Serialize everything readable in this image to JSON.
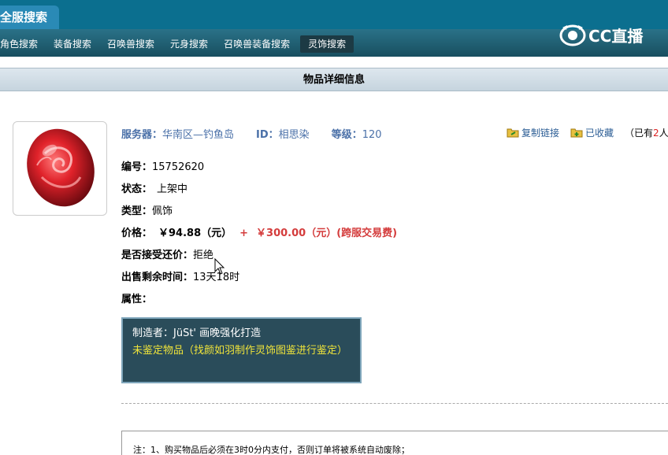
{
  "header": {
    "tab_all": "全服搜索",
    "nav": [
      "角色搜索",
      "装备搜索",
      "召唤兽搜索",
      "元身搜索",
      "召唤兽装备搜索",
      "灵饰搜索"
    ],
    "active_nav_index": 5,
    "logo_text": "CC直播"
  },
  "page_title": "物品详细信息",
  "item": {
    "server_label": "服务器：",
    "server_value": "华南区—钓鱼岛",
    "id_label": "ID：",
    "id_value": "相思染",
    "level_label": "等级：",
    "level_value": "120",
    "number_label": "编号：",
    "number_value": "15752620",
    "status_label": "状态：",
    "status_value": "上架中",
    "type_label": "类型：",
    "type_value": "佩饰",
    "price_label": "价格：",
    "price_value": "￥94.88（元）",
    "price_plus": "+",
    "price_fee": "￥300.00（元）(跨服交易费)",
    "bargain_label": "是否接受还价：",
    "bargain_value": "拒绝",
    "remaining_label": "出售剩余时间：",
    "remaining_value": "13天18时",
    "attr_label": "属性：",
    "attr_maker": "制造者：JüSt' 画晚强化打造",
    "attr_unidentified": "未鉴定物品（找颜如羽制作灵饰图鉴进行鉴定）"
  },
  "actions": {
    "copy_link": "复制链接",
    "favorited": "已收藏",
    "fav_note_prefix": "（已有",
    "fav_count": "2",
    "fav_note_suffix": "人收藏）"
  },
  "notes": {
    "line1": "注：1、购买物品后必须在3时0分内支付，否则订单将被系统自动废除；"
  },
  "colors": {
    "header_bg": "#0b6f8f",
    "info_blue": "#4a70a8",
    "price_red": "#d43c3c",
    "attr_box_bg": "#2a4c5a",
    "attr_yellow": "#f0e43a"
  }
}
